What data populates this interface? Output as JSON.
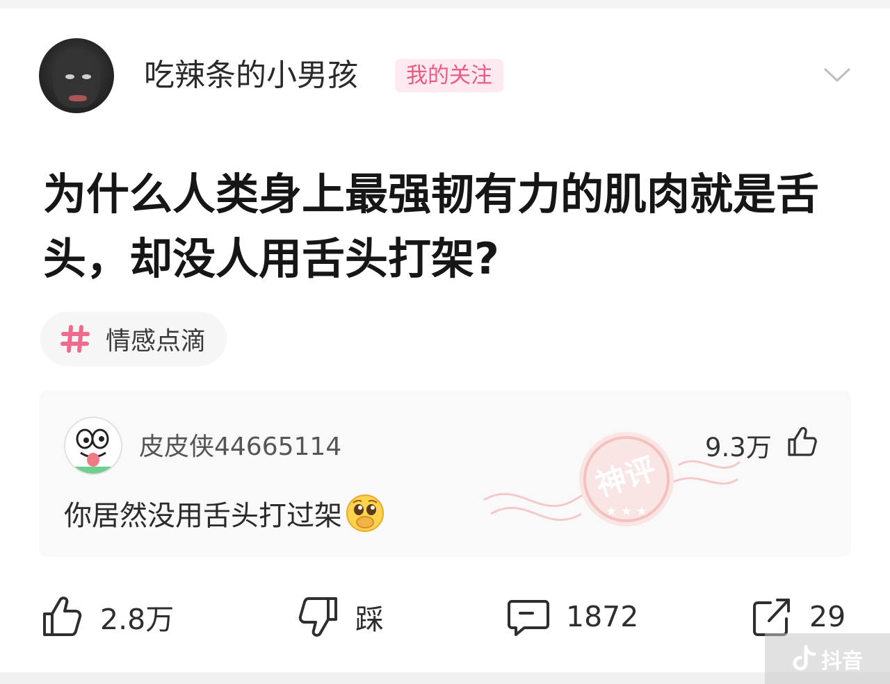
{
  "post": {
    "author": {
      "name": "吃辣条的小男孩",
      "follow_badge": "我的关注"
    },
    "title": "为什么人类身上最强韧有力的肌肉就是舌头，却没人用舌头打架?",
    "topic": {
      "label": "情感点滴",
      "icon": "hash-icon"
    }
  },
  "top_comment": {
    "author": "皮皮侠44665114",
    "likes": "9.3万",
    "text": "你居然没用舌头打过架",
    "emoji": "pleading-face-emoji",
    "stamp_text": "神评"
  },
  "actions": {
    "like": "2.8万",
    "dislike": "踩",
    "comments": "1872",
    "shares": "29"
  },
  "watermark": {
    "text": "抖音"
  },
  "colors": {
    "accent_pink": "#e95d84",
    "badge_bg": "#fde9ef",
    "stamp_red": "#e87878"
  }
}
